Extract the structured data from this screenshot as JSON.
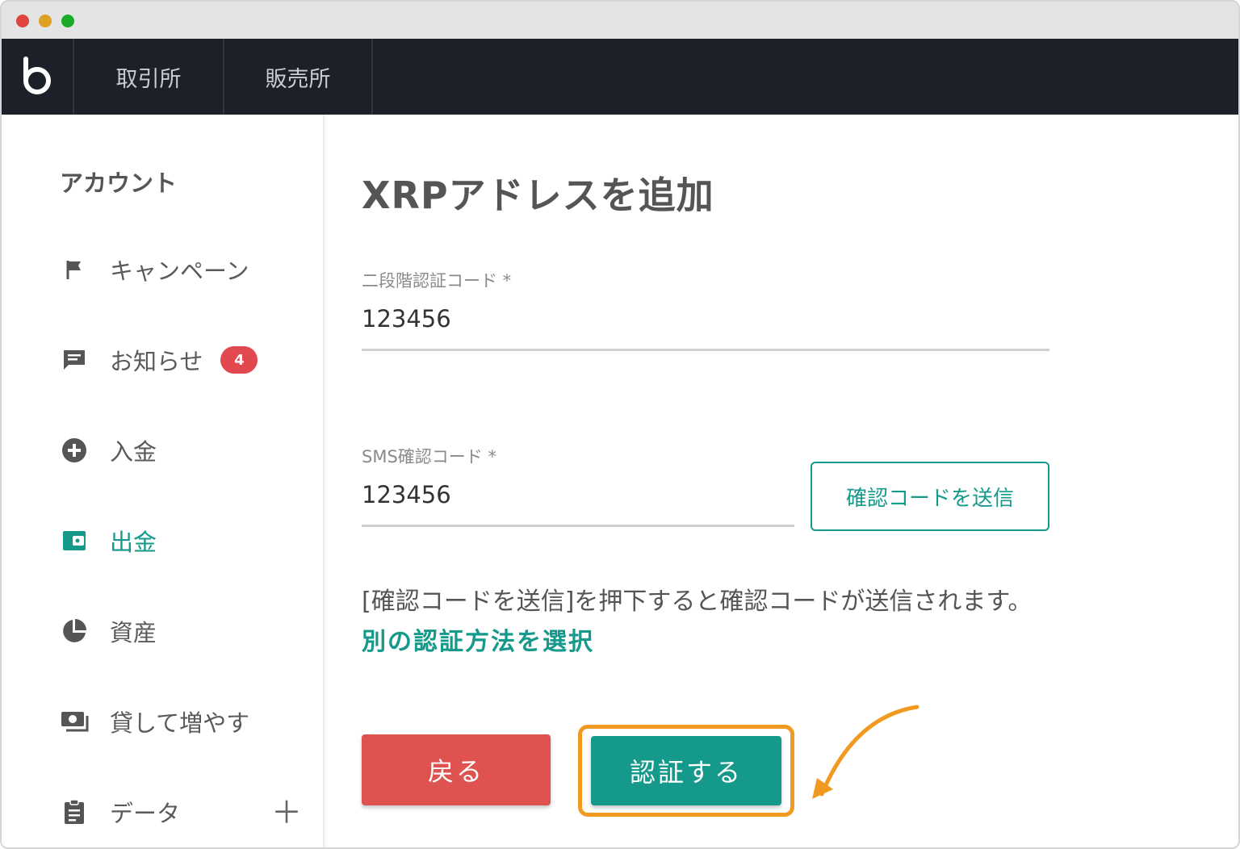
{
  "header": {
    "logo_icon": "bitbank-logo-icon",
    "tabs": [
      {
        "label": "取引所"
      },
      {
        "label": "販売所"
      }
    ]
  },
  "sidebar": {
    "title": "アカウント",
    "items": [
      {
        "label": "キャンペーン",
        "icon": "flag-icon"
      },
      {
        "label": "お知らせ",
        "icon": "message-icon",
        "badge": "4"
      },
      {
        "label": "入金",
        "icon": "plus-circle-icon"
      },
      {
        "label": "出金",
        "icon": "wallet-icon",
        "active": true
      },
      {
        "label": "資産",
        "icon": "pie-chart-icon"
      },
      {
        "label": "貸して増やす",
        "icon": "money-icon"
      },
      {
        "label": "データ",
        "icon": "clipboard-icon"
      }
    ],
    "expand_symbol": "＋"
  },
  "main": {
    "title": "XRPアドレスを追加",
    "two_factor": {
      "label": "二段階認証コード *",
      "value": "123456"
    },
    "sms": {
      "label": "SMS確認コード *",
      "value": "123456",
      "send_button": "確認コードを送信"
    },
    "info_text": "[確認コードを送信]を押下すると確認コードが送信されます。",
    "alt_method_link": "別の認証方法を選択",
    "back_button": "戻る",
    "auth_button": "認証する"
  },
  "colors": {
    "accent": "#14998a",
    "danger": "#de5350",
    "highlight": "#f29a1f",
    "nav_bg": "#1c2029",
    "badge": "#e2494f"
  }
}
